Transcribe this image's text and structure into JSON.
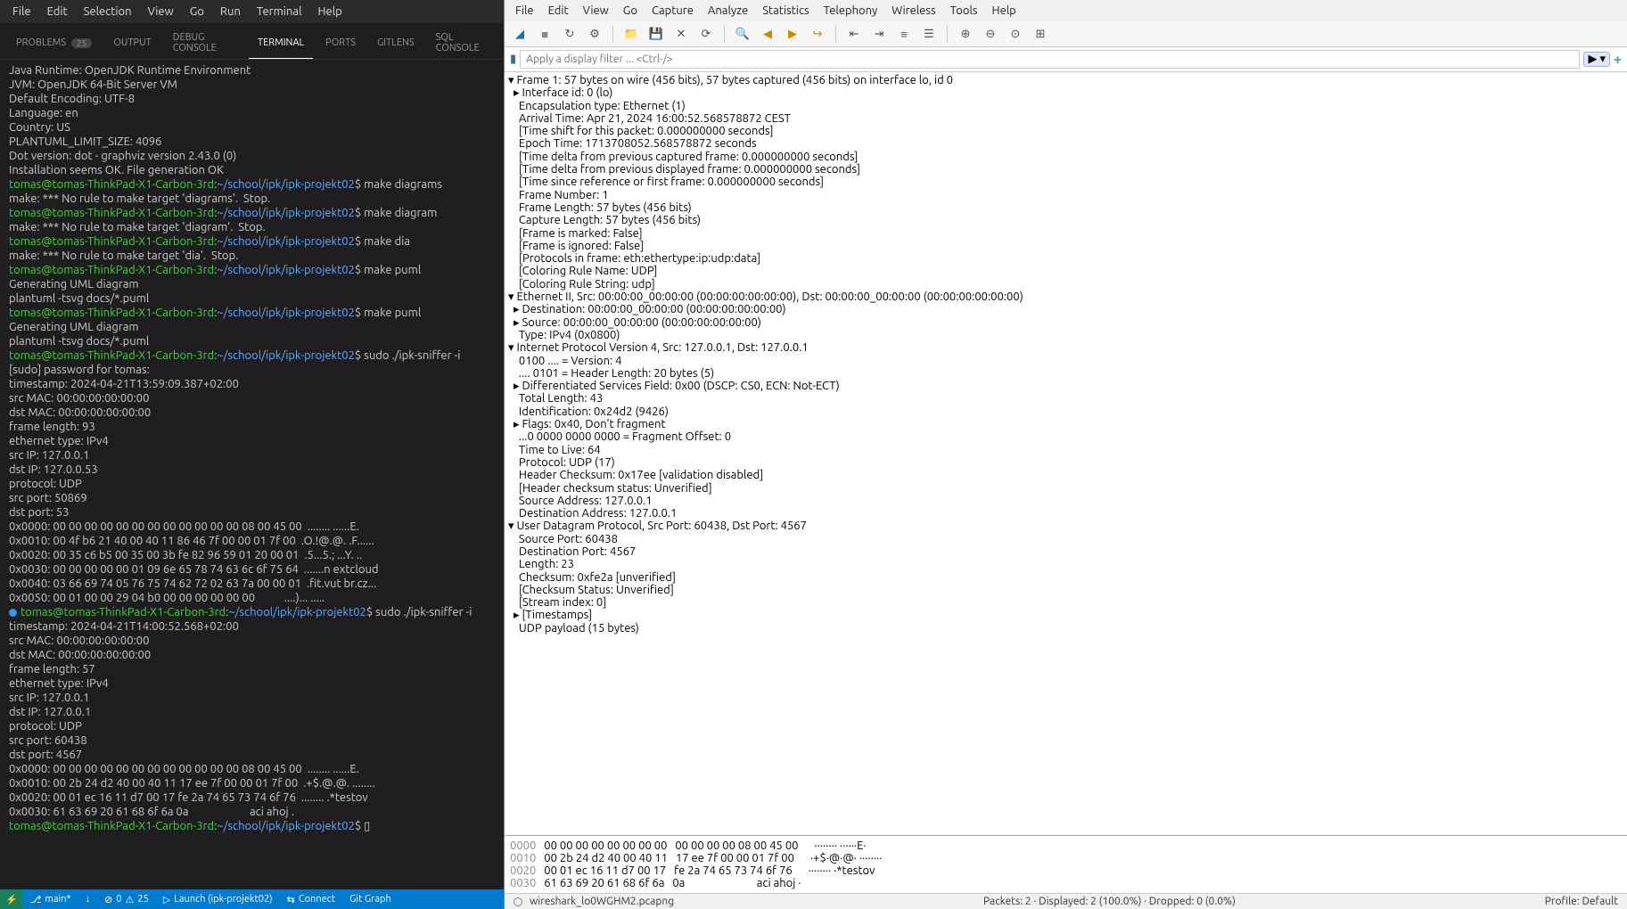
{
  "vscode": {
    "menu": [
      "File",
      "Edit",
      "Selection",
      "View",
      "Go",
      "Run",
      "Terminal",
      "Help"
    ],
    "tabs": [
      {
        "label": "PROBLEMS",
        "badge": "25"
      },
      {
        "label": "OUTPUT"
      },
      {
        "label": "DEBUG CONSOLE"
      },
      {
        "label": "TERMINAL",
        "active": true
      },
      {
        "label": "PORTS"
      },
      {
        "label": "GITLENS"
      },
      {
        "label": "SQL CONSOLE"
      }
    ],
    "prompt": {
      "user": "tomas@tomas-ThinkPad-X1-Carbon-3rd",
      "path": "~/school/ipk/ipk-projekt02",
      "sep": ":",
      "end": "$"
    },
    "lines": [
      {
        "t": "Java Runtime: OpenJDK Runtime Environment"
      },
      {
        "t": "JVM: OpenJDK 64-Bit Server VM"
      },
      {
        "t": "Default Encoding: UTF-8"
      },
      {
        "t": "Language: en"
      },
      {
        "t": "Country: US"
      },
      {
        "t": ""
      },
      {
        "t": "PLANTUML_LIMIT_SIZE: 4096"
      },
      {
        "t": ""
      },
      {
        "t": "Dot version: dot - graphviz version 2.43.0 (0)"
      },
      {
        "t": "Installation seems OK. File generation OK"
      },
      {
        "p": true,
        "cmd": " make diagrams"
      },
      {
        "t": "make: *** No rule to make target 'diagrams'.  Stop."
      },
      {
        "p": true,
        "cmd": " make diagram"
      },
      {
        "t": "make: *** No rule to make target 'diagram'.  Stop."
      },
      {
        "p": true,
        "cmd": " make dia"
      },
      {
        "t": "make: *** No rule to make target 'dia'.  Stop."
      },
      {
        "p": true,
        "cmd": " make puml"
      },
      {
        "t": "Generating UML diagram"
      },
      {
        "t": "plantuml -tsvg docs/*.puml"
      },
      {
        "p": true,
        "cmd": " make puml"
      },
      {
        "t": "Generating UML diagram"
      },
      {
        "t": "plantuml -tsvg docs/*.puml"
      },
      {
        "p": true,
        "cmd": " sudo ./ipk-sniffer -i"
      },
      {
        "t": "[sudo] password for tomas: "
      },
      {
        "t": "timestamp: 2024-04-21T13:59:09.387+02:00"
      },
      {
        "t": "src MAC: 00:00:00:00:00:00"
      },
      {
        "t": "dst MAC: 00:00:00:00:00:00"
      },
      {
        "t": "frame length: 93"
      },
      {
        "t": "ethernet type: IPv4"
      },
      {
        "t": "src IP: 127.0.0.1"
      },
      {
        "t": "dst IP: 127.0.0.53"
      },
      {
        "t": "protocol: UDP"
      },
      {
        "t": "src port: 50869"
      },
      {
        "t": "dst port: 53"
      },
      {
        "t": "0x0000: 00 00 00 00 00 00 00 00 00 00 00 00 08 00 45 00  ........ ......E."
      },
      {
        "t": "0x0010: 00 4f b6 21 40 00 40 11 86 46 7f 00 00 01 7f 00  .O.!@.@. .F......"
      },
      {
        "t": "0x0020: 00 35 c6 b5 00 35 00 3b fe 82 96 59 01 20 00 01  .5...5.; ...Y. .."
      },
      {
        "t": "0x0030: 00 00 00 00 00 01 09 6e 65 78 74 63 6c 6f 75 64  .......n extcloud"
      },
      {
        "t": "0x0040: 03 66 69 74 05 76 75 74 62 72 02 63 7a 00 00 01  .fit.vut br.cz..."
      },
      {
        "t": "0x0050: 00 01 00 00 29 04 b0 00 00 00 00 00 00           ....)... ....."
      },
      {
        "t": ""
      },
      {
        "p": true,
        "cmd": " sudo ./ipk-sniffer -i",
        "circle": true
      },
      {
        "t": "timestamp: 2024-04-21T14:00:52.568+02:00"
      },
      {
        "t": "src MAC: 00:00:00:00:00:00"
      },
      {
        "t": "dst MAC: 00:00:00:00:00:00"
      },
      {
        "t": "frame length: 57"
      },
      {
        "t": "ethernet type: IPv4"
      },
      {
        "t": "src IP: 127.0.0.1"
      },
      {
        "t": "dst IP: 127.0.0.1"
      },
      {
        "t": "protocol: UDP"
      },
      {
        "t": "src port: 60438"
      },
      {
        "t": "dst port: 4567"
      },
      {
        "t": "0x0000: 00 00 00 00 00 00 00 00 00 00 00 00 08 00 45 00  ........ ......E."
      },
      {
        "t": "0x0010: 00 2b 24 d2 40 00 40 11 17 ee 7f 00 00 01 7f 00  .+$.@.@. ........"
      },
      {
        "t": "0x0020: 00 01 ec 16 11 d7 00 17 fe 2a 74 65 73 74 6f 76  ........ .*testov"
      },
      {
        "t": "0x0030: 61 63 69 20 61 68 6f 6a 0a                       aci ahoj ."
      },
      {
        "t": ""
      },
      {
        "p": true,
        "cmd": " ▯"
      }
    ],
    "status": {
      "branch": "main*",
      "sync": "↓",
      "errors": "0",
      "warnings": "25",
      "launch": "Launch (ipk-projekt02)",
      "connect": "Connect",
      "gitgraph": "Git Graph"
    }
  },
  "wireshark": {
    "menu": [
      "File",
      "Edit",
      "View",
      "Go",
      "Capture",
      "Analyze",
      "Statistics",
      "Telephony",
      "Wireless",
      "Tools",
      "Help"
    ],
    "filter_placeholder": "Apply a display filter ... <Ctrl-/>",
    "tree": [
      {
        "i": 0,
        "exp": "d",
        "t": "Frame 1: 57 bytes on wire (456 bits), 57 bytes captured (456 bits) on interface lo, id 0"
      },
      {
        "i": 1,
        "exp": "r",
        "t": "Interface id: 0 (lo)"
      },
      {
        "i": 1,
        "t": "Encapsulation type: Ethernet (1)"
      },
      {
        "i": 1,
        "t": "Arrival Time: Apr 21, 2024 16:00:52.568578872 CEST"
      },
      {
        "i": 1,
        "t": "[Time shift for this packet: 0.000000000 seconds]"
      },
      {
        "i": 1,
        "t": "Epoch Time: 1713708052.568578872 seconds"
      },
      {
        "i": 1,
        "t": "[Time delta from previous captured frame: 0.000000000 seconds]"
      },
      {
        "i": 1,
        "t": "[Time delta from previous displayed frame: 0.000000000 seconds]"
      },
      {
        "i": 1,
        "t": "[Time since reference or first frame: 0.000000000 seconds]"
      },
      {
        "i": 1,
        "t": "Frame Number: 1"
      },
      {
        "i": 1,
        "t": "Frame Length: 57 bytes (456 bits)"
      },
      {
        "i": 1,
        "t": "Capture Length: 57 bytes (456 bits)"
      },
      {
        "i": 1,
        "t": "[Frame is marked: False]"
      },
      {
        "i": 1,
        "t": "[Frame is ignored: False]"
      },
      {
        "i": 1,
        "t": "[Protocols in frame: eth:ethertype:ip:udp:data]"
      },
      {
        "i": 1,
        "t": "[Coloring Rule Name: UDP]"
      },
      {
        "i": 1,
        "t": "[Coloring Rule String: udp]"
      },
      {
        "i": 0,
        "exp": "d",
        "t": "Ethernet II, Src: 00:00:00_00:00:00 (00:00:00:00:00:00), Dst: 00:00:00_00:00:00 (00:00:00:00:00:00)"
      },
      {
        "i": 1,
        "exp": "r",
        "t": "Destination: 00:00:00_00:00:00 (00:00:00:00:00:00)"
      },
      {
        "i": 1,
        "exp": "r",
        "t": "Source: 00:00:00_00:00:00 (00:00:00:00:00:00)"
      },
      {
        "i": 1,
        "t": "Type: IPv4 (0x0800)"
      },
      {
        "i": 0,
        "exp": "d",
        "t": "Internet Protocol Version 4, Src: 127.0.0.1, Dst: 127.0.0.1"
      },
      {
        "i": 1,
        "t": "0100 .... = Version: 4"
      },
      {
        "i": 1,
        "t": ".... 0101 = Header Length: 20 bytes (5)"
      },
      {
        "i": 1,
        "exp": "r",
        "t": "Differentiated Services Field: 0x00 (DSCP: CS0, ECN: Not-ECT)"
      },
      {
        "i": 1,
        "t": "Total Length: 43"
      },
      {
        "i": 1,
        "t": "Identification: 0x24d2 (9426)"
      },
      {
        "i": 1,
        "exp": "r",
        "t": "Flags: 0x40, Don't fragment"
      },
      {
        "i": 1,
        "t": "...0 0000 0000 0000 = Fragment Offset: 0"
      },
      {
        "i": 1,
        "t": "Time to Live: 64"
      },
      {
        "i": 1,
        "t": "Protocol: UDP (17)"
      },
      {
        "i": 1,
        "t": "Header Checksum: 0x17ee [validation disabled]"
      },
      {
        "i": 1,
        "t": "[Header checksum status: Unverified]"
      },
      {
        "i": 1,
        "t": "Source Address: 127.0.0.1"
      },
      {
        "i": 1,
        "t": "Destination Address: 127.0.0.1"
      },
      {
        "i": 0,
        "exp": "d",
        "t": "User Datagram Protocol, Src Port: 60438, Dst Port: 4567"
      },
      {
        "i": 1,
        "t": "Source Port: 60438"
      },
      {
        "i": 1,
        "t": "Destination Port: 4567"
      },
      {
        "i": 1,
        "t": "Length: 23"
      },
      {
        "i": 1,
        "t": "Checksum: 0xfe2a [unverified]"
      },
      {
        "i": 1,
        "t": "[Checksum Status: Unverified]"
      },
      {
        "i": 1,
        "t": "[Stream index: 0]"
      },
      {
        "i": 1,
        "exp": "r",
        "t": "[Timestamps]"
      },
      {
        "i": 1,
        "t": "UDP payload (15 bytes)"
      }
    ],
    "hex": [
      {
        "off": "0000",
        "b": "00 00 00 00 00 00 00 00   00 00 00 00 08 00 45 00",
        "a": "········ ······E·"
      },
      {
        "off": "0010",
        "b": "00 2b 24 d2 40 00 40 11   17 ee 7f 00 00 01 7f 00",
        "a": "·+$·@·@· ········"
      },
      {
        "off": "0020",
        "b": "00 01 ec 16 11 d7 00 17   fe 2a 74 65 73 74 6f 76",
        "a": "········ ·*testov"
      },
      {
        "off": "0030",
        "b": "61 63 69 20 61 68 6f 6a   0a",
        "a": "aci ahoj ·"
      }
    ],
    "status": {
      "file": "wireshark_lo0WGHM2.pcapng",
      "packets": "Packets: 2 · Displayed: 2 (100.0%) · Dropped: 0 (0.0%)",
      "profile": "Profile: Default"
    }
  }
}
